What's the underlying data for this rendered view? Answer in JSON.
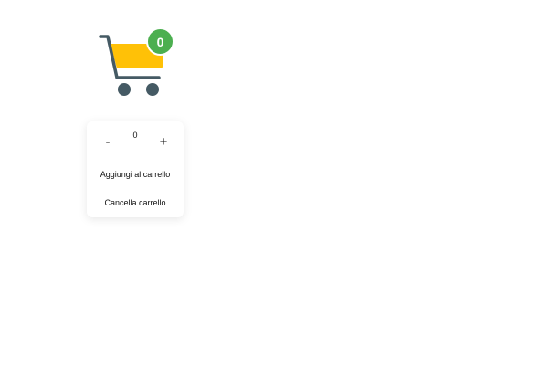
{
  "cart": {
    "icon": "shopping-cart-icon",
    "badge_count": "0",
    "badge_color": "#4caf50",
    "basket_color": "#ffc107",
    "frame_color": "#455a64"
  },
  "controls": {
    "decrement_label": "-",
    "quantity_value": "0",
    "increment_label": "+",
    "add_to_cart_label": "Aggiungi al carrello",
    "clear_cart_label": "Cancella carrello"
  }
}
